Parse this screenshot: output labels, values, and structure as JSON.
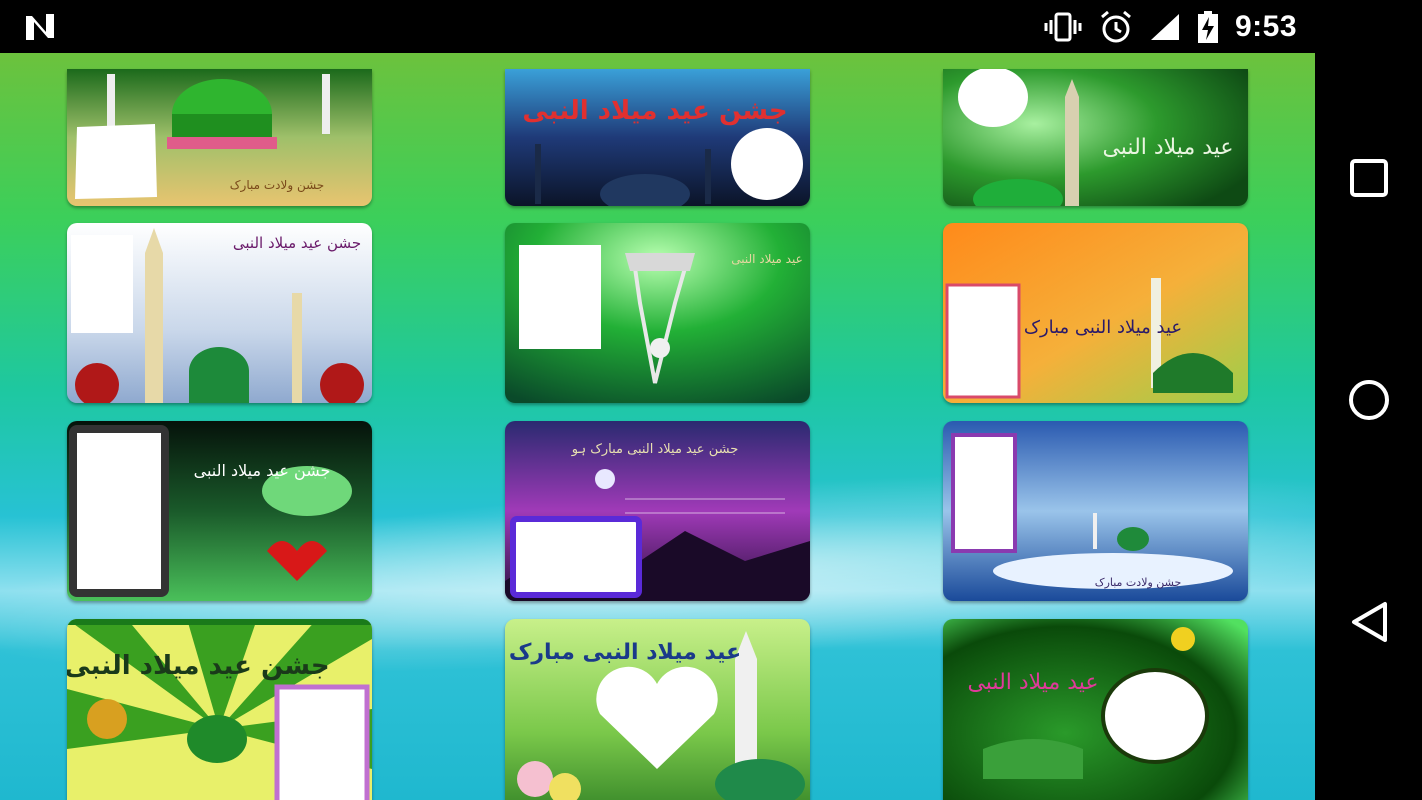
{
  "status_bar": {
    "time": "9:53",
    "notification_icon": "n-logo-icon",
    "icons": [
      "vibrate-icon",
      "alarm-icon",
      "signal-icon",
      "battery-charging-icon"
    ]
  },
  "nav_bar": {
    "buttons": [
      "recents-square-icon",
      "home-circle-icon",
      "back-triangle-icon"
    ]
  },
  "cards": [
    {
      "id": "card-1",
      "arabic": "جشن ولادت مبارک",
      "theme": "madina-dome-gold"
    },
    {
      "id": "card-2",
      "arabic": "جشن عید میلاد النبی",
      "theme": "night-blue-mosque"
    },
    {
      "id": "card-3",
      "arabic": "عید میلاد النبی",
      "theme": "green-minaret"
    },
    {
      "id": "card-4",
      "arabic": "جشن عید میلاد النبی",
      "theme": "white-sky-roses"
    },
    {
      "id": "card-5",
      "arabic": "عید میلاد النبی",
      "theme": "green-naalain"
    },
    {
      "id": "card-6",
      "arabic": "عید میلاد النبی مبارک",
      "theme": "orange-green"
    },
    {
      "id": "card-7",
      "arabic": "جشن عید میلاد النبی",
      "theme": "night-lights-heart"
    },
    {
      "id": "card-8",
      "arabic": "جشن عید میلاد النبی مبارک ہو",
      "theme": "purple-moon"
    },
    {
      "id": "card-9",
      "arabic": "جشن ولادت مبارک",
      "theme": "blue-winter"
    },
    {
      "id": "card-10",
      "arabic": "جشن عید میلاد النبی",
      "theme": "sunburst-yellow"
    },
    {
      "id": "card-11",
      "arabic": "عید میلاد النبی مبارک",
      "theme": "leaves-heart"
    },
    {
      "id": "card-12",
      "arabic": "عید میلاد النبی",
      "theme": "dark-green-oval"
    }
  ]
}
